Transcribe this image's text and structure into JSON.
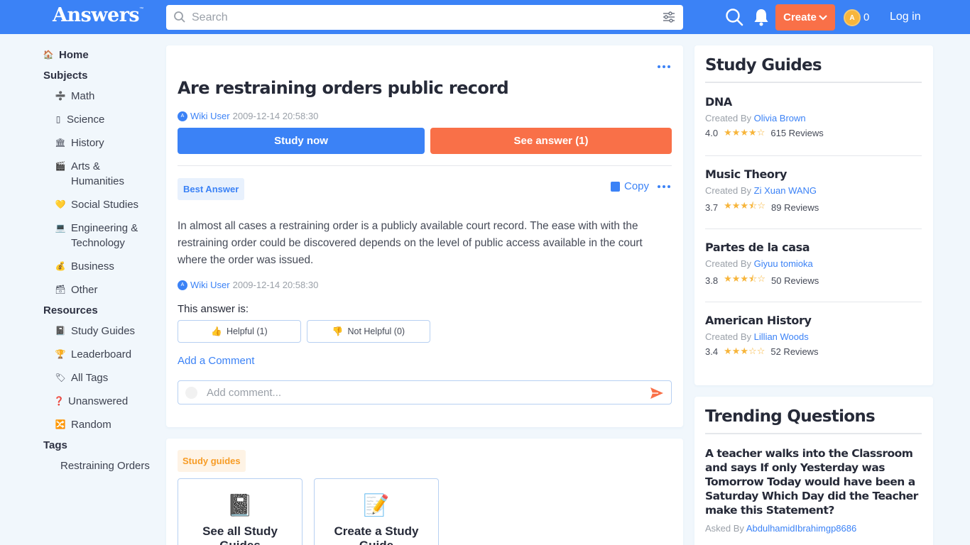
{
  "header": {
    "logo": "Answers",
    "logo_tm": "™",
    "search_placeholder": "Search",
    "create_label": "Create",
    "coin_count": "0",
    "login_label": "Log in"
  },
  "sidebar": {
    "home": "Home",
    "subjects_heading": "Subjects",
    "subjects": [
      "Math",
      "Science",
      "History",
      "Arts &",
      "Humanities",
      "Social Studies",
      "Engineering &",
      "Technology",
      "Business",
      "Other"
    ],
    "resources_heading": "Resources",
    "resources": [
      "Study Guides",
      "Leaderboard",
      "All Tags",
      "Unanswered",
      "Random"
    ],
    "tags_heading": "Tags",
    "tags": [
      "Restraining Orders"
    ]
  },
  "question": {
    "title": "Are restraining orders public record",
    "user": "Wiki User",
    "date": "2009-12-14 20:58:30",
    "study_now": "Study now",
    "see_answer": "See answer (1)"
  },
  "answer": {
    "badge": "Best Answer",
    "copy_label": "Copy",
    "text": "In almost all cases a restraining order is a publicly available court record. The ease with with the restraining order could be discovered depends on the level of public access available in the court where the order was issued.",
    "user": "Wiki User",
    "date": "2009-12-14 20:58:30",
    "this_answer_is": "This answer is:",
    "helpful": "Helpful (1)",
    "not_helpful": "Not Helpful (0)",
    "add_comment": "Add a Comment",
    "comment_placeholder": "Add comment..."
  },
  "study_guides_section": {
    "badge": "Study guides",
    "see_all_line1": "See all Study",
    "see_all_line2": "Guides",
    "create_line1": "Create a Study",
    "create_line2": "Guide"
  },
  "right_guides": {
    "title": "Study Guides",
    "created_by": "Created By",
    "items": [
      {
        "name": "DNA",
        "author": "Olivia Brown",
        "rating": "4.0",
        "stars": "★★★★☆",
        "reviews": "615 Reviews"
      },
      {
        "name": "Music Theory",
        "author": "Zi Xuan WANG",
        "rating": "3.7",
        "stars": "★★★⯪☆",
        "reviews": "89 Reviews"
      },
      {
        "name": "Partes de la casa",
        "author": "Giyuu tomioka",
        "rating": "3.8",
        "stars": "★★★⯪☆",
        "reviews": "50 Reviews"
      },
      {
        "name": "American History",
        "author": "Lillian Woods",
        "rating": "3.4",
        "stars": "★★★☆☆",
        "reviews": "52 Reviews"
      }
    ]
  },
  "trending": {
    "title": "Trending Questions",
    "question": "A teacher walks into the Classroom and says If only Yesterday was Tomorrow Today would have been a Saturday Which Day did the Teacher make this Statement?",
    "asked_by": "Asked By",
    "author": "AbdulhamidIbrahimgp8686"
  },
  "colors": {
    "brand_blue": "#3b82f6",
    "accent_orange": "#f97048",
    "star": "#f7b53b"
  }
}
